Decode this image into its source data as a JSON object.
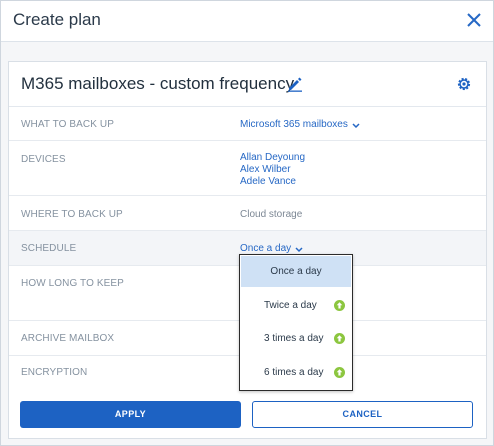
{
  "dialog": {
    "title": "Create plan"
  },
  "plan": {
    "name": "M365 mailboxes - custom frequency"
  },
  "rows": {
    "what_label": "WHAT TO BACK UP",
    "what_value": "Microsoft 365 mailboxes",
    "devices_label": "DEVICES",
    "devices": [
      "Allan Deyoung",
      "Alex Wilber",
      "Adele Vance"
    ],
    "where_label": "WHERE TO BACK UP",
    "where_value": "Cloud storage",
    "schedule_label": "SCHEDULE",
    "schedule_value": "Once a day",
    "keep_label": "HOW LONG TO KEEP",
    "archive_label": "ARCHIVE MAILBOX",
    "encryption_label": "ENCRYPTION"
  },
  "dropdown": {
    "options": [
      {
        "label": "Once a day",
        "selected": true,
        "upgrade": false
      },
      {
        "label": "Twice a day",
        "selected": false,
        "upgrade": true
      },
      {
        "label": "3 times a day",
        "selected": false,
        "upgrade": true
      },
      {
        "label": "6 times a day",
        "selected": false,
        "upgrade": true
      }
    ]
  },
  "footer": {
    "apply_label": "APPLY",
    "cancel_label": "CANCEL"
  },
  "colors": {
    "accent": "#1d62c3",
    "link": "#2668c5",
    "upgrade_icon": "#8cc63f",
    "selected_option": "#cfe1f5"
  },
  "icons": {
    "close": "close-icon",
    "edit": "pencil-icon",
    "settings": "gear-icon",
    "chevron": "chevron-down-icon",
    "upgrade": "upgrade-arrow-icon"
  }
}
